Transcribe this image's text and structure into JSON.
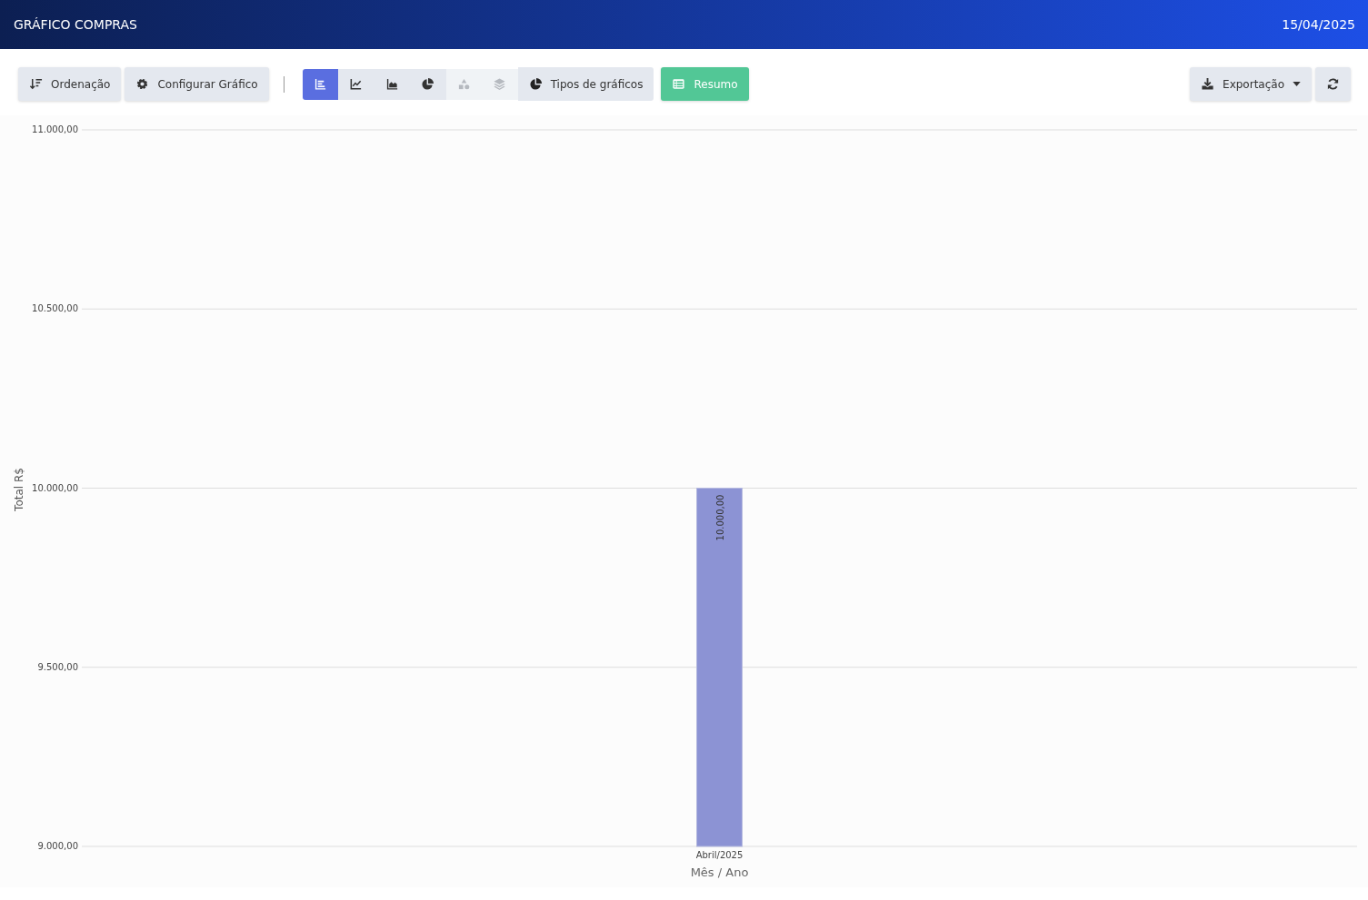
{
  "header": {
    "title": "GRÁFICO COMPRAS",
    "date": "15/04/2025"
  },
  "toolbar": {
    "sort_button": "Ordenação",
    "config_button": "Configurar Gráfico",
    "chart_types": [
      {
        "kind": "bar",
        "selected": true,
        "disabled": false
      },
      {
        "kind": "line",
        "selected": false,
        "disabled": false
      },
      {
        "kind": "area",
        "selected": false,
        "disabled": false
      },
      {
        "kind": "pie",
        "selected": false,
        "disabled": false
      },
      {
        "kind": "shapes",
        "selected": false,
        "disabled": true
      },
      {
        "kind": "layers",
        "selected": false,
        "disabled": true
      }
    ],
    "types_button": "Tipos de gráficos",
    "summary_button": "Resumo",
    "export_button": "Exportação"
  },
  "chart": {
    "chart_data": {
      "type": "bar",
      "xlabel": "Mês / Ano",
      "ylabel": "Total R$",
      "categories": [
        "Abril/2025"
      ],
      "series": [
        {
          "color": "#8c93d4",
          "values": [
            10000
          ]
        }
      ],
      "grid": true,
      "ylim": [
        9000,
        11000
      ],
      "yticks": [
        {
          "value": 9000,
          "label": "9.000,00"
        },
        {
          "value": 9500,
          "label": "9.500,00"
        },
        {
          "value": 10000,
          "label": "10.000,00"
        },
        {
          "value": 10500,
          "label": "10.500,00"
        },
        {
          "value": 11000,
          "label": "11.000,00"
        }
      ],
      "value_labels": [
        "10.000,00"
      ]
    }
  }
}
